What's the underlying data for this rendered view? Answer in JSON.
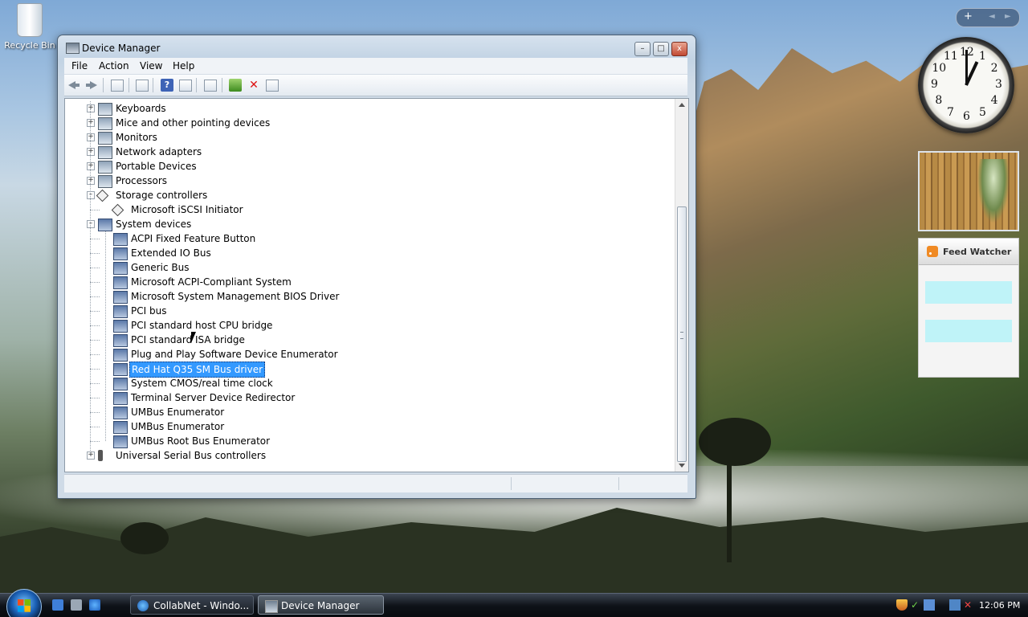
{
  "desktop": {
    "recycle_bin_label": "Recycle Bin"
  },
  "window": {
    "title": "Device Manager",
    "buttons": {
      "minimize": "–",
      "maximize": "□",
      "close": "x"
    },
    "menu": [
      "File",
      "Action",
      "View",
      "Help"
    ],
    "toolbar_icons": [
      "back-icon",
      "forward-icon",
      "properties-icon",
      "show-hide-icon",
      "help-icon",
      "view-icon",
      "scan-hardware-icon",
      "update-driver-icon",
      "uninstall-icon",
      "disable-icon"
    ]
  },
  "tree": {
    "items": [
      {
        "label": "Keyboards",
        "expander": "+",
        "selected": false
      },
      {
        "label": "Mice and other pointing devices",
        "expander": "+",
        "selected": false
      },
      {
        "label": "Monitors",
        "expander": "+",
        "selected": false
      },
      {
        "label": "Network adapters",
        "expander": "+",
        "selected": false
      },
      {
        "label": "Portable Devices",
        "expander": "+",
        "selected": false
      },
      {
        "label": "Processors",
        "expander": "+",
        "selected": false
      },
      {
        "label": "Storage controllers",
        "expander": "–",
        "selected": false
      },
      {
        "label": "Microsoft iSCSI Initiator",
        "expander": "",
        "selected": false
      },
      {
        "label": "System devices",
        "expander": "–",
        "selected": false
      },
      {
        "label": "ACPI Fixed Feature Button",
        "expander": "",
        "selected": false
      },
      {
        "label": "Extended IO Bus",
        "expander": "",
        "selected": false
      },
      {
        "label": "Generic Bus",
        "expander": "",
        "selected": false
      },
      {
        "label": "Microsoft ACPI-Compliant System",
        "expander": "",
        "selected": false
      },
      {
        "label": "Microsoft System Management BIOS Driver",
        "expander": "",
        "selected": false
      },
      {
        "label": "PCI bus",
        "expander": "",
        "selected": false
      },
      {
        "label": "PCI standard host CPU bridge",
        "expander": "",
        "selected": false
      },
      {
        "label": "PCI standard ISA bridge",
        "expander": "",
        "selected": false
      },
      {
        "label": "Plug and Play Software Device Enumerator",
        "expander": "",
        "selected": false
      },
      {
        "label": "Red Hat Q35 SM Bus driver",
        "expander": "",
        "selected": true
      },
      {
        "label": "System CMOS/real time clock",
        "expander": "",
        "selected": false
      },
      {
        "label": "Terminal Server Device Redirector",
        "expander": "",
        "selected": false
      },
      {
        "label": "UMBus Enumerator",
        "expander": "",
        "selected": false
      },
      {
        "label": "UMBus Enumerator",
        "expander": "",
        "selected": false
      },
      {
        "label": "UMBus Root Bus Enumerator",
        "expander": "",
        "selected": false
      },
      {
        "label": "Universal Serial Bus controllers",
        "expander": "+",
        "selected": false
      }
    ]
  },
  "gadgets": {
    "clock_numbers": [
      "12",
      "1",
      "2",
      "3",
      "4",
      "5",
      "6",
      "7",
      "8",
      "9",
      "10",
      "11"
    ],
    "feed_watcher_title": "Feed Watcher"
  },
  "taskbar": {
    "tasks": [
      {
        "label": "CollabNet - Windo...",
        "active": false
      },
      {
        "label": "Device Manager",
        "active": true
      }
    ],
    "time": "12:06 PM"
  },
  "colors": {
    "selection": "#3399ff",
    "feed_slot": "#bff3f8"
  }
}
